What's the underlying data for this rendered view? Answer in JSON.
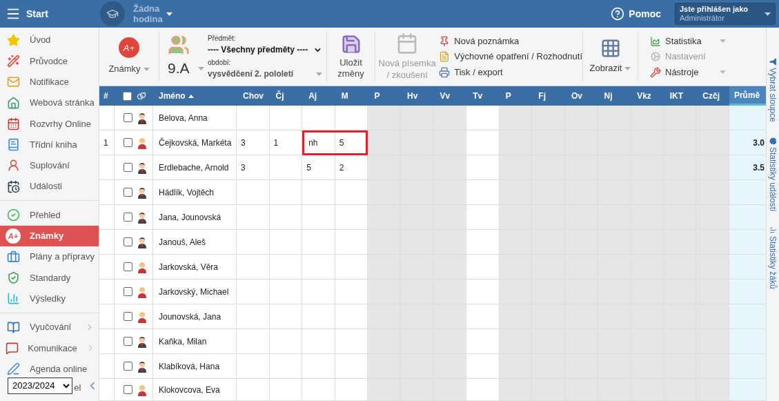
{
  "top_bar": {
    "title": "Start",
    "lesson": "Žádna hodina",
    "help": "Pomoc",
    "user_caption": "Jste přihlášen jako",
    "user_name": "Administrátor"
  },
  "sidebar": {
    "sections": [
      {
        "items": [
          {
            "label": "Úvod",
            "kind": "star",
            "selected": false,
            "submenu": false
          },
          {
            "label": "Průvodce",
            "kind": "wand",
            "selected": false,
            "submenu": false
          },
          {
            "label": "Notifikace",
            "kind": "mail",
            "selected": false,
            "submenu": false
          },
          {
            "label": "Webová stránka",
            "kind": "house",
            "selected": false,
            "submenu": false
          },
          {
            "label": "Rozvrhy Online",
            "kind": "timetable",
            "selected": false,
            "submenu": false
          },
          {
            "label": "Třídní kniha",
            "kind": "book",
            "selected": false,
            "submenu": false
          },
          {
            "label": "Suplování",
            "kind": "person",
            "selected": false,
            "submenu": false
          },
          {
            "label": "Události",
            "kind": "calendar",
            "selected": false,
            "submenu": false
          }
        ]
      },
      {
        "items": [
          {
            "label": "Přehled",
            "kind": "check",
            "selected": false,
            "submenu": false
          },
          {
            "label": "Známky",
            "kind": "grades",
            "icon_text": "A+",
            "selected": true,
            "submenu": false
          },
          {
            "label": "Plány a přípravy",
            "kind": "briefcase",
            "selected": false,
            "submenu": false
          },
          {
            "label": "Standardy",
            "kind": "shield",
            "selected": false,
            "submenu": false
          },
          {
            "label": "Výsledky",
            "kind": "chart",
            "selected": false,
            "submenu": false
          }
        ]
      },
      {
        "items": [
          {
            "label": "Vyučování",
            "kind": "open-book",
            "selected": false,
            "submenu": true
          },
          {
            "label": "Komunikace",
            "kind": "chat",
            "selected": false,
            "submenu": true
          },
          {
            "label": "Agenda online",
            "kind": "pen",
            "selected": false,
            "submenu": false
          }
        ]
      }
    ],
    "footer": {
      "year": "2023/2024",
      "item_label": "el"
    }
  },
  "toolbar": {
    "grades_button": {
      "label": "Známky",
      "icon_text": "A+",
      "dropdown": true
    },
    "class_button": {
      "label": "9.A",
      "dropdown": true
    },
    "subject": {
      "label": "Předmět:",
      "value": "---- Všechny předměty ----"
    },
    "period": {
      "label": "období:",
      "value": "vysvědčení 2. pololetí",
      "dropdown": true
    },
    "save_button": {
      "label": "Uložit změny",
      "disabled": false
    },
    "new_test_button": {
      "label": "Nová písemka / zkoušení",
      "disabled": true
    },
    "actions": [
      {
        "label": "Nová poznámka",
        "kind": "pin"
      },
      {
        "label": "Výchovné opatření / Rozhodnutí",
        "kind": "document"
      },
      {
        "label": "Tisk / export",
        "kind": "print"
      }
    ],
    "view_button": {
      "label": "Zobrazit",
      "dropdown": true
    },
    "tools": [
      {
        "label": "Statistika",
        "kind": "stats",
        "disabled": false,
        "dropdown": true
      },
      {
        "label": "Nastavení",
        "kind": "settings",
        "disabled": true,
        "dropdown": false
      },
      {
        "label": "Nástroje",
        "kind": "tools",
        "disabled": false,
        "dropdown": true
      }
    ]
  },
  "table": {
    "number_header": "#",
    "all_checked": false,
    "name_column": {
      "label": "Jméno",
      "sort_ascending": true
    },
    "columns": [
      {
        "label": "Chov",
        "editable": true,
        "highlighted": false
      },
      {
        "label": "Čj",
        "editable": true,
        "highlighted": false
      },
      {
        "label": "Aj",
        "editable": true,
        "highlighted": true
      },
      {
        "label": "M",
        "editable": true,
        "highlighted": true
      },
      {
        "label": "P",
        "editable": false,
        "highlighted": false
      },
      {
        "label": "Hv",
        "editable": false,
        "highlighted": false
      },
      {
        "label": "Vv",
        "editable": false,
        "highlighted": false
      },
      {
        "label": "Tv",
        "editable": true,
        "highlighted": false
      },
      {
        "label": "P",
        "editable": false,
        "highlighted": false
      },
      {
        "label": "Fj",
        "editable": false,
        "highlighted": false
      },
      {
        "label": "Ov",
        "editable": false,
        "highlighted": false
      },
      {
        "label": "Nj",
        "editable": false,
        "highlighted": false
      },
      {
        "label": "Vkz",
        "editable": false,
        "highlighted": false
      },
      {
        "label": "IKT",
        "editable": false,
        "highlighted": false
      },
      {
        "label": "Czčj",
        "editable": false,
        "highlighted": false
      }
    ],
    "average_header": "Průmě",
    "rows": [
      {
        "name": "Belova, Anna",
        "kind": "male",
        "checked": false,
        "highlighted": false
      },
      {
        "number": "1",
        "name": "Čejkovská, Markéta",
        "kind": "female",
        "checked": false,
        "highlighted": true,
        "cells": [
          "3",
          "1",
          "nh",
          "5"
        ],
        "average": "3.0"
      },
      {
        "name": "Erdlebache, Arnold",
        "kind": "male",
        "checked": false,
        "highlighted": false,
        "cells": [
          "3",
          null,
          "5",
          "2"
        ],
        "average": "3.5"
      },
      {
        "name": "Hádlík, Vojtěch",
        "kind": "male",
        "checked": false,
        "highlighted": false
      },
      {
        "name": "Jana, Jounovská",
        "kind": "male",
        "checked": false,
        "highlighted": false
      },
      {
        "name": "Janouš, Aleš",
        "kind": "male",
        "checked": false,
        "highlighted": false
      },
      {
        "name": "Jarkovská, Věra",
        "kind": "female",
        "checked": false,
        "highlighted": false
      },
      {
        "name": "Jarkovský, Michael",
        "kind": "female",
        "checked": false,
        "highlighted": false
      },
      {
        "name": "Jounovská, Jana",
        "kind": "female",
        "checked": false,
        "highlighted": false
      },
      {
        "name": "Kaňka, Milan",
        "kind": "male",
        "checked": false,
        "highlighted": false
      },
      {
        "name": "Klabíková, Hana",
        "kind": "male",
        "checked": false,
        "highlighted": false
      },
      {
        "name": "Klokovcova, Eva",
        "kind": "female",
        "checked": false,
        "highlighted": false
      }
    ]
  },
  "side_panel": [
    {
      "label": "Vybrat sloupce",
      "kind": "filter"
    },
    {
      "label": "Statistiky událostí",
      "kind": "pie"
    },
    {
      "label": "Statistiky žáků",
      "kind": "chart"
    }
  ]
}
